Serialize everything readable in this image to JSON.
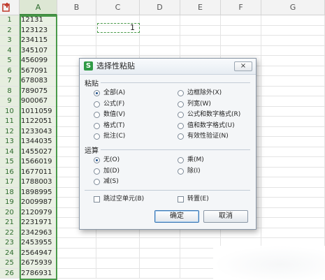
{
  "columns": [
    "A",
    "B",
    "C",
    "D",
    "E",
    "F",
    "G"
  ],
  "rows": [
    {
      "n": "1",
      "a": "12131"
    },
    {
      "n": "2",
      "a": "123123"
    },
    {
      "n": "3",
      "a": "234115"
    },
    {
      "n": "4",
      "a": "345107"
    },
    {
      "n": "5",
      "a": "456099"
    },
    {
      "n": "6",
      "a": "567091"
    },
    {
      "n": "7",
      "a": "678083"
    },
    {
      "n": "8",
      "a": "789075"
    },
    {
      "n": "9",
      "a": "900067"
    },
    {
      "n": "10",
      "a": "1011059"
    },
    {
      "n": "11",
      "a": "1122051"
    },
    {
      "n": "12",
      "a": "1233043"
    },
    {
      "n": "13",
      "a": "1344035"
    },
    {
      "n": "14",
      "a": "1455027"
    },
    {
      "n": "15",
      "a": "1566019"
    },
    {
      "n": "16",
      "a": "1677011"
    },
    {
      "n": "17",
      "a": "1788003"
    },
    {
      "n": "18",
      "a": "1898995"
    },
    {
      "n": "19",
      "a": "2009987"
    },
    {
      "n": "20",
      "a": "2120979"
    },
    {
      "n": "21",
      "a": "2231971"
    },
    {
      "n": "22",
      "a": "2342963"
    },
    {
      "n": "23",
      "a": "2453955"
    },
    {
      "n": "24",
      "a": "2564947"
    },
    {
      "n": "25",
      "a": "2675939"
    },
    {
      "n": "26",
      "a": "2786931"
    }
  ],
  "copied_cell_value": "1",
  "dialog": {
    "title": "选择性粘贴",
    "close_label": "×",
    "paste_group": "粘贴",
    "paste_left": [
      {
        "label": "全部(A)",
        "checked": true
      },
      {
        "label": "公式(F)",
        "checked": false
      },
      {
        "label": "数值(V)",
        "checked": false
      },
      {
        "label": "格式(T)",
        "checked": false
      },
      {
        "label": "批注(C)",
        "checked": false
      }
    ],
    "paste_right": [
      {
        "label": "边框除外(X)",
        "checked": false
      },
      {
        "label": "列宽(W)",
        "checked": false
      },
      {
        "label": "公式和数字格式(R)",
        "checked": false
      },
      {
        "label": "值和数字格式(U)",
        "checked": false
      },
      {
        "label": "有效性验证(N)",
        "checked": false
      }
    ],
    "operation_group": "运算",
    "op_left": [
      {
        "label": "无(O)",
        "checked": true
      },
      {
        "label": "加(D)",
        "checked": false
      },
      {
        "label": "减(S)",
        "checked": false
      }
    ],
    "op_right": [
      {
        "label": "乘(M)",
        "checked": false
      },
      {
        "label": "除(I)",
        "checked": false
      }
    ],
    "skip_blanks": "跳过空单元(B)",
    "transpose": "转置(E)",
    "ok_label": "确定",
    "cancel_label": "取消"
  },
  "colors": {
    "selection": "#4a9a4a",
    "accent": "#1e4f8a"
  },
  "icons": {
    "corner": "paste-icon"
  }
}
